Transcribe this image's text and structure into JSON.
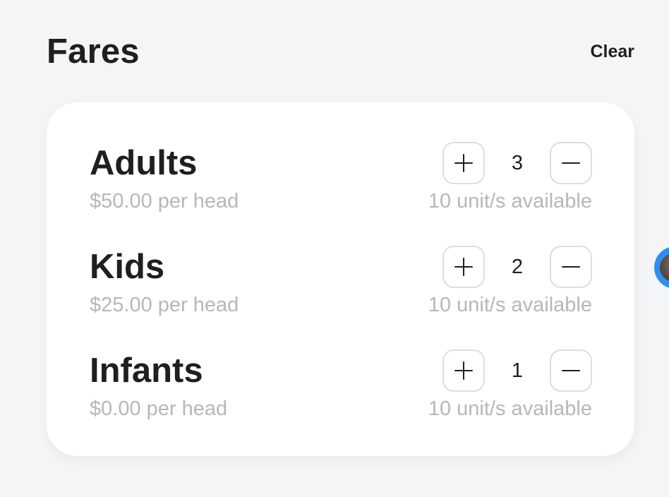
{
  "header": {
    "title": "Fares",
    "clear_label": "Clear"
  },
  "fares": [
    {
      "name": "Adults",
      "price": "$50.00 per head",
      "quantity": "3",
      "availability": "10 unit/s available"
    },
    {
      "name": "Kids",
      "price": "$25.00 per head",
      "quantity": "2",
      "availability": "10 unit/s available"
    },
    {
      "name": "Infants",
      "price": "$0.00 per head",
      "quantity": "1",
      "availability": "10 unit/s available"
    }
  ],
  "icons": {
    "increment": "plus-icon",
    "decrement": "minus-icon",
    "chat": "chat-avatar-icon"
  },
  "colors": {
    "background": "#f4f5f7",
    "card": "#ffffff",
    "text": "#1f1f1f",
    "muted_text": "#b7b7b7",
    "button_border": "#dedede",
    "chat_bubble": "#2f8ef0"
  }
}
